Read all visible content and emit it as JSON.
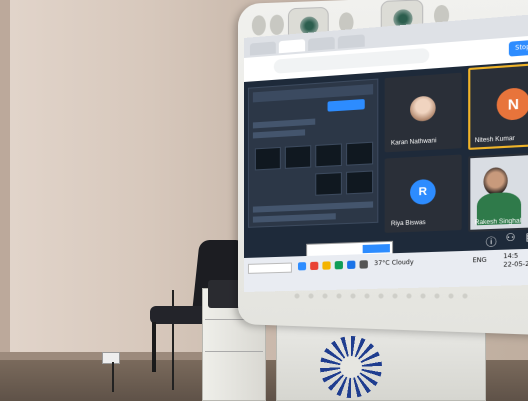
{
  "scene": {
    "description_type": "photo",
    "colors": {
      "wall": "#d7c8bc",
      "screen_bg": "#1e2a3a",
      "accent_blue": "#2d8cff",
      "active_tile_border": "#f0b429"
    }
  },
  "browser": {
    "stop_button": "Stop S"
  },
  "meeting": {
    "participants": [
      {
        "name": "Karan Nathwani",
        "type": "photo"
      },
      {
        "name": "Nitesh Kumar",
        "initial": "N",
        "avatar_color": "#e8743b",
        "active": true
      },
      {
        "name": "Riya Biswas",
        "initial": "R",
        "avatar_color": "#2d8cff"
      },
      {
        "name": "Rakesh Singhal",
        "type": "video"
      }
    ],
    "controls": [
      "info-icon",
      "participants-icon",
      "chat-icon"
    ]
  },
  "taskbar": {
    "weather": "37°C Cloudy",
    "language": "ENG",
    "time": "14:5",
    "date": "22-05-2"
  }
}
